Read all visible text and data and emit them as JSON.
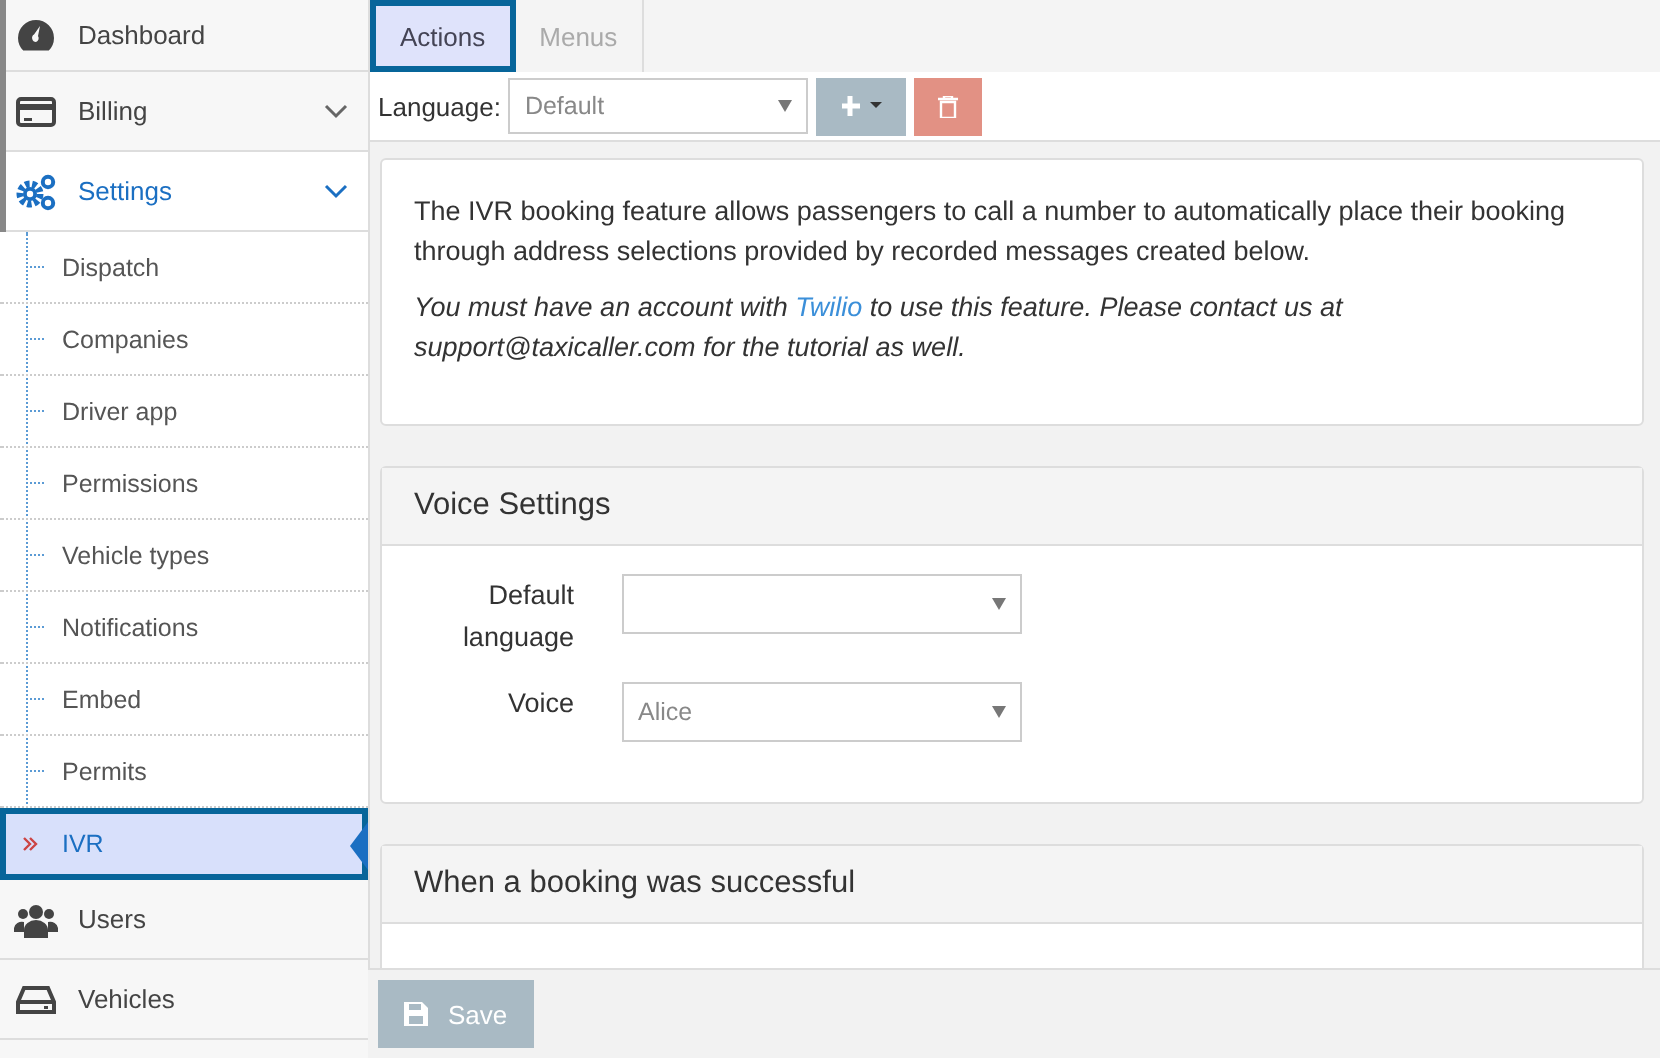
{
  "sidebar": {
    "items": [
      {
        "label": "Dashboard",
        "selected": false,
        "expandable": false
      },
      {
        "label": "Billing",
        "selected": false,
        "expandable": true
      },
      {
        "label": "Settings",
        "selected": true,
        "expandable": true,
        "children": [
          {
            "label": "Dispatch",
            "selected": false
          },
          {
            "label": "Companies",
            "selected": false
          },
          {
            "label": "Driver app",
            "selected": false
          },
          {
            "label": "Permissions",
            "selected": false
          },
          {
            "label": "Vehicle types",
            "selected": false
          },
          {
            "label": "Notifications",
            "selected": false
          },
          {
            "label": "Embed",
            "selected": false
          },
          {
            "label": "Permits",
            "selected": false
          },
          {
            "label": "IVR",
            "selected": true
          }
        ]
      },
      {
        "label": "Users",
        "selected": false,
        "expandable": false
      },
      {
        "label": "Vehicles",
        "selected": false,
        "expandable": false
      }
    ]
  },
  "tabs": [
    {
      "label": "Actions",
      "selected": true
    },
    {
      "label": "Menus",
      "selected": false
    }
  ],
  "toolbar": {
    "label": "Language:",
    "select": {
      "value": "Default"
    }
  },
  "info": {
    "paragraph": "The IVR booking feature allows passengers to call a number to automatically place their booking through address selections provided by recorded messages created below.",
    "note_before": "You must have an account with ",
    "note_link": "Twilio",
    "note_after": " to use this feature. Please contact us at support@taxicaller.com for the tutorial as well."
  },
  "sections": [
    {
      "title": "Voice Settings",
      "fields": [
        {
          "label": "Default language"
        },
        {
          "label": "Voice",
          "value": "Alice"
        }
      ]
    },
    {
      "title": "When a booking was successful"
    }
  ],
  "footer": {
    "save_button": "Save",
    "disabled": true
  }
}
